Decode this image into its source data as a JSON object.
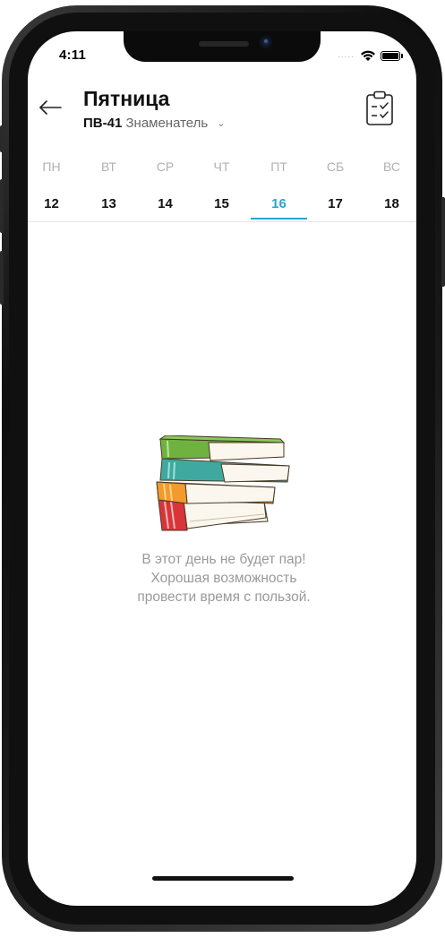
{
  "status_bar": {
    "time": "4:11",
    "signal_dots": "....."
  },
  "header": {
    "title": "Пятница",
    "group": "ПВ-41",
    "week_type": "Знаменатель",
    "back_icon": "arrow-left-icon",
    "action_icon": "clipboard-checklist-icon"
  },
  "week": {
    "days": [
      {
        "name": "ПН",
        "number": "12"
      },
      {
        "name": "ВТ",
        "number": "13"
      },
      {
        "name": "СР",
        "number": "14"
      },
      {
        "name": "ЧТ",
        "number": "15"
      },
      {
        "name": "ПТ",
        "number": "16"
      },
      {
        "name": "СБ",
        "number": "17"
      },
      {
        "name": "ВС",
        "number": "18"
      }
    ],
    "selected_index": 4
  },
  "empty_state": {
    "illustration": "stack-of-books",
    "line1": "В этот день не будет пар!",
    "line2": "Хорошая возможность",
    "line3": "провести время с пользой."
  },
  "colors": {
    "accent": "#2aa4cc",
    "muted_text": "#9a9a9a",
    "day_name": "#b1b1b1"
  }
}
